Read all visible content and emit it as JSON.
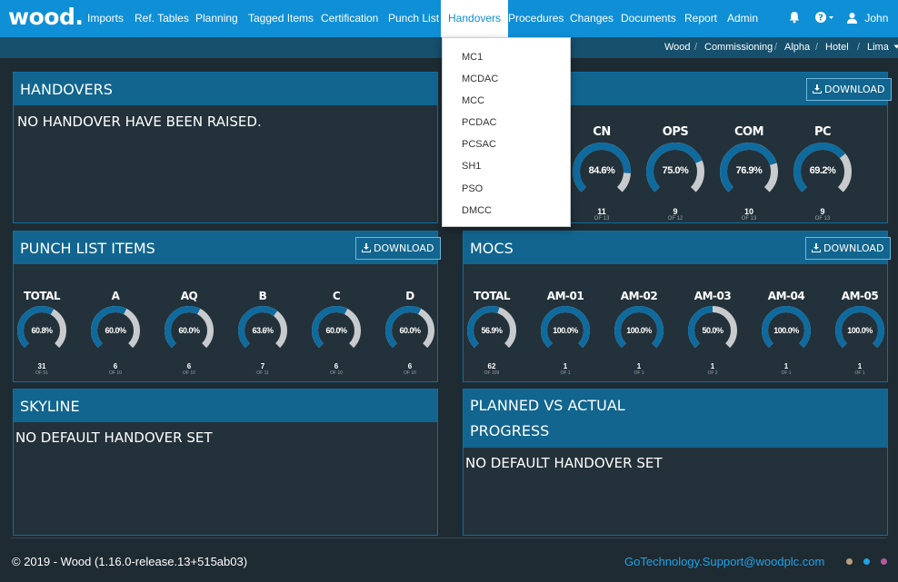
{
  "app": {
    "logo": "wood",
    "logo_dot": ".",
    "user": "John"
  },
  "nav": {
    "items": [
      "Imports",
      "Ref. Tables",
      "Planning",
      "Tagged Items",
      "Certification",
      "Punch List",
      "Handovers",
      "Procedures",
      "Changes",
      "Documents",
      "Report",
      "Admin"
    ],
    "active": "Handovers"
  },
  "breadcrumb": [
    "Wood",
    "Commissioning",
    "Alpha",
    "Hotel",
    "Lima"
  ],
  "dropdown": {
    "items": [
      "MC1",
      "MCDAC",
      "MCC",
      "PCDAC",
      "PCSAC",
      "SH1",
      "PSO",
      "DMCC"
    ]
  },
  "handovers": {
    "title": "HANDOVERS",
    "message": "NO HANDOVER HAVE BEEN RAISED."
  },
  "certification": {
    "download_label": "DOWNLOAD",
    "gauges": [
      {
        "label": "CN",
        "pct": "84.6%",
        "value": 0.846,
        "count": "11",
        "of": "OF 13"
      },
      {
        "label": "OPS",
        "pct": "75.0%",
        "value": 0.75,
        "count": "9",
        "of": "OF 12"
      },
      {
        "label": "COM",
        "pct": "76.9%",
        "value": 0.769,
        "count": "10",
        "of": "OF 13"
      },
      {
        "label": "PC",
        "pct": "69.2%",
        "value": 0.692,
        "count": "9",
        "of": "OF 13"
      }
    ]
  },
  "punch": {
    "title": "PUNCH LIST ITEMS",
    "download_label": "DOWNLOAD",
    "gauges": [
      {
        "label": "TOTAL",
        "pct": "60.8%",
        "value": 0.608,
        "count": "31",
        "of": "OF 51"
      },
      {
        "label": "A",
        "pct": "60.0%",
        "value": 0.6,
        "count": "6",
        "of": "OF 10"
      },
      {
        "label": "AQ",
        "pct": "60.0%",
        "value": 0.6,
        "count": "6",
        "of": "OF 10"
      },
      {
        "label": "B",
        "pct": "63.6%",
        "value": 0.636,
        "count": "7",
        "of": "OF 11"
      },
      {
        "label": "C",
        "pct": "60.0%",
        "value": 0.6,
        "count": "6",
        "of": "OF 10"
      },
      {
        "label": "D",
        "pct": "60.0%",
        "value": 0.6,
        "count": "6",
        "of": "OF 10"
      }
    ]
  },
  "mocs": {
    "title": "MOCS",
    "download_label": "DOWNLOAD",
    "gauges": [
      {
        "label": "TOTAL",
        "pct": "56.9%",
        "value": 0.569,
        "count": "62",
        "of": "OF 109"
      },
      {
        "label": "AM-01",
        "pct": "100.0%",
        "value": 1.0,
        "count": "1",
        "of": "OF 1"
      },
      {
        "label": "AM-02",
        "pct": "100.0%",
        "value": 1.0,
        "count": "1",
        "of": "OF 1"
      },
      {
        "label": "AM-03",
        "pct": "50.0%",
        "value": 0.5,
        "count": "1",
        "of": "OF 2"
      },
      {
        "label": "AM-04",
        "pct": "100.0%",
        "value": 1.0,
        "count": "1",
        "of": "OF 1"
      },
      {
        "label": "AM-05",
        "pct": "100.0%",
        "value": 1.0,
        "count": "1",
        "of": "OF 1"
      }
    ]
  },
  "skyline": {
    "title": "SKYLINE",
    "message": "NO DEFAULT HANDOVER SET"
  },
  "planned": {
    "title_line1": "PLANNED VS ACTUAL",
    "title_line2": "PROGRESS",
    "message": "NO DEFAULT HANDOVER SET"
  },
  "footer": {
    "copyright": "© 2019 - Wood (1.16.0-release.13+515ab03)",
    "support": "GoTechnology.Support@woodplc.com"
  },
  "colors": {
    "nav_bg": "#0f8fd6",
    "panel_head": "#11658f",
    "gauge_fill": "#0f6b9e",
    "gauge_track": "#c8cbcd",
    "dots": [
      "#b6a080",
      "#1fa3e6",
      "#b45a9c"
    ]
  }
}
